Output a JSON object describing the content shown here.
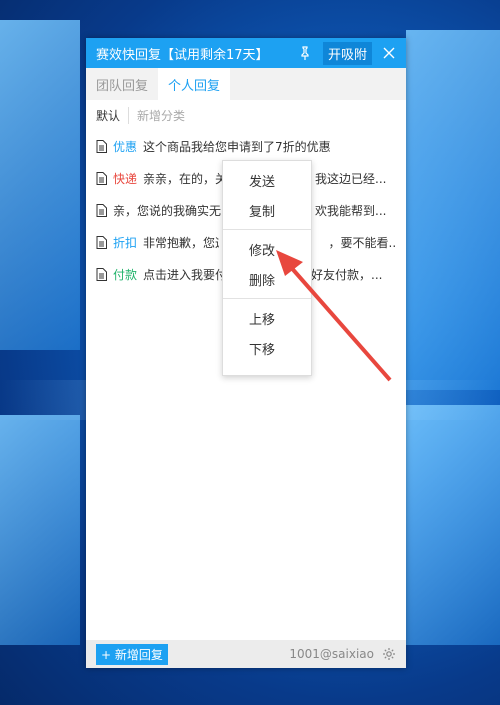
{
  "window": {
    "title": "赛效快回复【试用剩余17天】",
    "attach_label": "开吸附"
  },
  "tabs": [
    {
      "label": "团队回复",
      "active": false
    },
    {
      "label": "个人回复",
      "active": true
    }
  ],
  "categories": {
    "default": "默认",
    "add": "新增分类"
  },
  "replies": [
    {
      "tag": "优惠",
      "tag_color": "#1da1f2",
      "text": "这个商品我给您申请到了7折的优惠"
    },
    {
      "tag": "快递",
      "tag_color": "#e8473e",
      "text": "亲亲，在的，关",
      "tail": "我这边已经..."
    },
    {
      "tag": "",
      "tag_color": "#333333",
      "text": "亲，您说的我确实无",
      "tail": "欢我能帮到..."
    },
    {
      "tag": "折扣",
      "tag_color": "#1da1f2",
      "text": "非常抱歉，您这",
      "tail": "，要不能看..."
    },
    {
      "tag": "付款",
      "tag_color": "#21b36b",
      "text": "点击进入我要付",
      "tail": "好友付款，..."
    }
  ],
  "context_menu": {
    "send": "发送",
    "copy": "复制",
    "edit": "修改",
    "delete": "删除",
    "move_up": "上移",
    "move_down": "下移"
  },
  "footer": {
    "add_label": "+ 新增回复",
    "account": "1001@saixiao"
  },
  "colors": {
    "accent": "#1da1f2",
    "arrow": "#e8473e"
  }
}
